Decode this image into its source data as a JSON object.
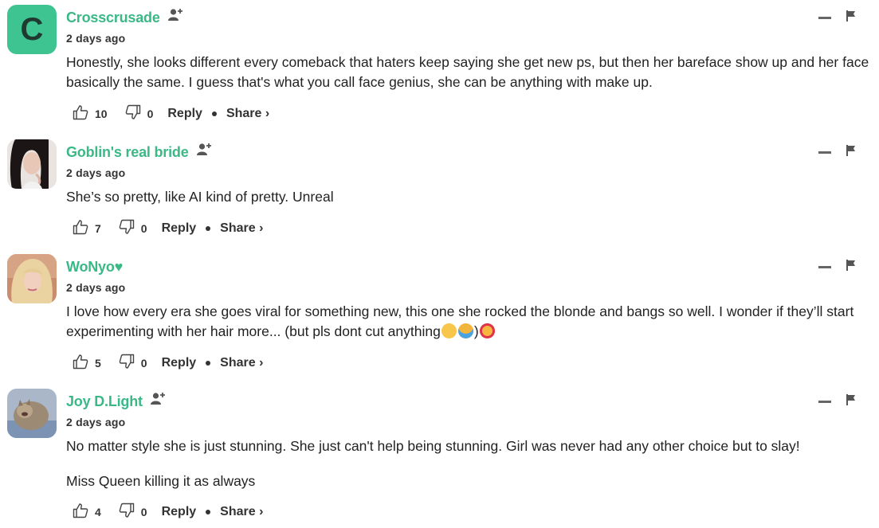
{
  "comments": [
    {
      "username": "Crosscrusade",
      "avatar_letter": "C",
      "time": "2 days ago",
      "text": "Honestly, she looks different every comeback that haters keep saying she get new ps, but then her bareface show up and her face basically the same. I guess that's what you call face genius, she can be anything with make up.",
      "likes": "10",
      "dislikes": "0",
      "reply": "Reply",
      "share": "Share ›"
    },
    {
      "username": "Goblin's real bride",
      "time": "2 days ago",
      "text": "She’s so pretty, like AI kind of pretty. Unreal",
      "likes": "7",
      "dislikes": "0",
      "reply": "Reply",
      "share": "Share ›"
    },
    {
      "username": "WoNyo♥",
      "time": "2 days ago",
      "text": "I love how every era she goes viral for something new, this one she rocked the blonde and bangs so well. I wonder if they’ll start experimenting with her hair more... (but pls dont cut anything",
      "emoji_tail": ")",
      "likes": "5",
      "dislikes": "0",
      "reply": "Reply",
      "share": "Share ›"
    },
    {
      "username": "Joy D.Light",
      "time": "2 days ago",
      "text": "No matter style she is just stunning. She just can't help being stunning. Girl was never had any other choice but to slay!",
      "text2": "Miss Queen killing it as always",
      "likes": "4",
      "dislikes": "0",
      "reply": "Reply",
      "share": "Share ›"
    }
  ],
  "icons": {
    "like": "thumbs-up-icon",
    "dislike": "thumbs-down-icon",
    "follow": "add-user-icon",
    "collapse": "minus-icon",
    "report": "flag-icon"
  },
  "colors": {
    "username": "#3ab886",
    "avatar_letter_bg": "#3ec491"
  }
}
